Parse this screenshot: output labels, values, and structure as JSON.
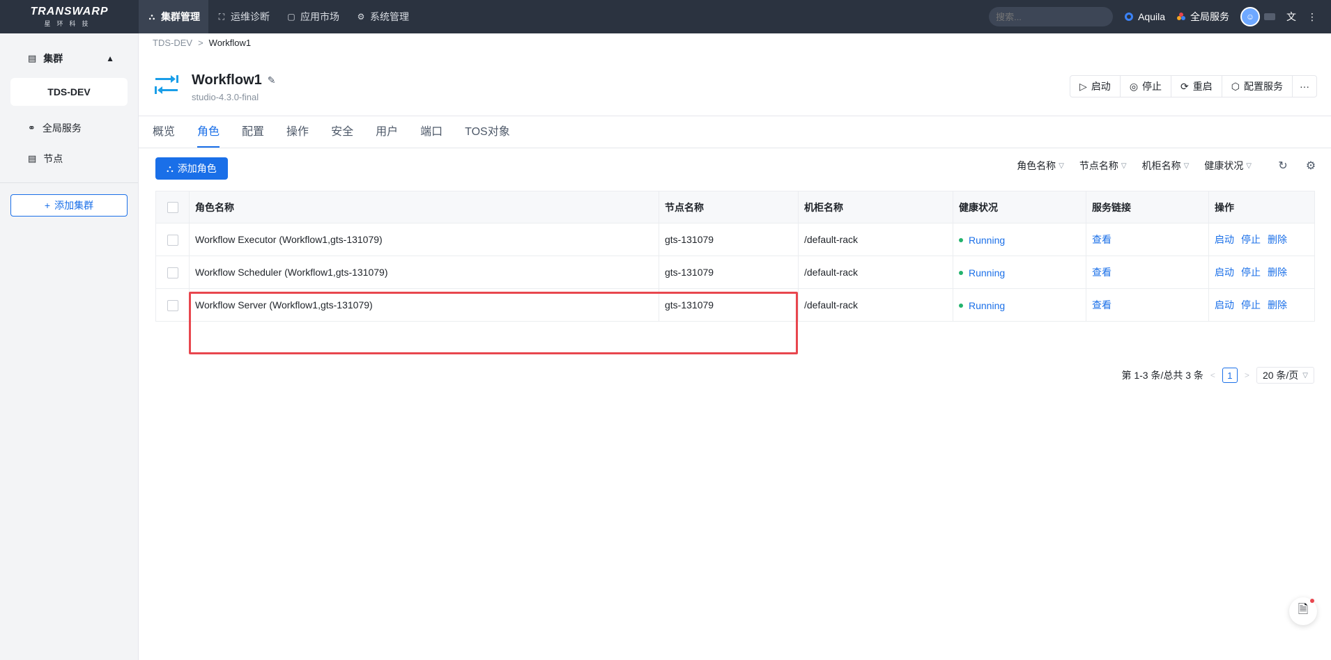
{
  "topbar": {
    "brand": "TRANSWARP",
    "brand_sub": "星环科技",
    "nav": [
      {
        "label": "集群管理",
        "icon": "cluster-icon",
        "active": true
      },
      {
        "label": "运维诊断",
        "icon": "diagnose-icon"
      },
      {
        "label": "应用市场",
        "icon": "market-icon"
      },
      {
        "label": "系统管理",
        "icon": "gear-icon"
      }
    ],
    "search_placeholder": "搜索...",
    "aquila": "Aquila",
    "global_services": "全局服务",
    "lang_icon": "translate-icon",
    "more_icon": "more-vertical-icon"
  },
  "sidebar": {
    "section": "集群",
    "cluster": "TDS-DEV",
    "items": [
      {
        "label": "全局服务",
        "icon": "global-services-icon"
      },
      {
        "label": "节点",
        "icon": "node-icon"
      }
    ],
    "add_cluster": "添加集群"
  },
  "breadcrumb": {
    "root": "TDS-DEV",
    "sep": ">",
    "current": "Workflow1"
  },
  "service": {
    "name": "Workflow1",
    "version": "studio-4.3.0-final",
    "actions": [
      "启动",
      "停止",
      "重启",
      "配置服务"
    ],
    "more": "···"
  },
  "tabs": [
    "概览",
    "角色",
    "配置",
    "操作",
    "安全",
    "用户",
    "端口",
    "TOS对象"
  ],
  "active_tab": 1,
  "toolbar": {
    "add_role": "添加角色",
    "filters": [
      "角色名称",
      "节点名称",
      "机柜名称",
      "健康状况"
    ]
  },
  "table": {
    "columns": [
      "角色名称",
      "节点名称",
      "机柜名称",
      "健康状况",
      "服务链接",
      "操作"
    ],
    "rows": [
      {
        "role": "Workflow Executor (Workflow1,gts-131079)",
        "node": "gts-131079",
        "rack": "/default-rack",
        "health": "Running",
        "link": "查看",
        "ops": [
          "启动",
          "停止",
          "删除"
        ]
      },
      {
        "role": "Workflow Scheduler (Workflow1,gts-131079)",
        "node": "gts-131079",
        "rack": "/default-rack",
        "health": "Running",
        "link": "查看",
        "ops": [
          "启动",
          "停止",
          "删除"
        ]
      },
      {
        "role": "Workflow Server (Workflow1,gts-131079)",
        "node": "gts-131079",
        "rack": "/default-rack",
        "health": "Running",
        "link": "查看",
        "ops": [
          "启动",
          "停止",
          "删除"
        ]
      }
    ]
  },
  "pager": {
    "summary": "第 1-3 条/总共 3 条",
    "prev": "<",
    "next": ">",
    "page": "1",
    "size": "20 条/页"
  },
  "colors": {
    "accent": "#1a6fe8",
    "topbar": "#2b3340",
    "highlight": "#e8464e",
    "running_dot": "#23b26d"
  }
}
